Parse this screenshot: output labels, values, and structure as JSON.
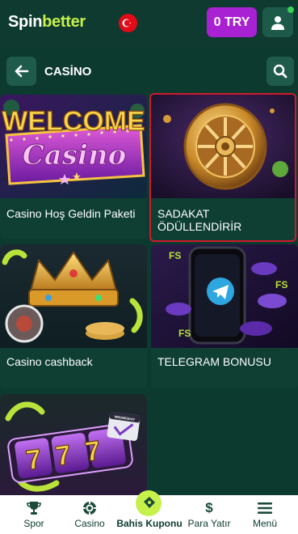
{
  "header": {
    "logo_spin": "Spin",
    "logo_better": "better",
    "balance_label": "0 TRY"
  },
  "titlebar": {
    "title": "CASİNO"
  },
  "cards": [
    {
      "label": "Casino Hoş Geldin Paketi",
      "art_text_1": "WELCOME",
      "art_text_2": "Casino"
    },
    {
      "label": "SADAKAT ÖDÜLLENDİRİR"
    },
    {
      "label": "Casino cashback"
    },
    {
      "label": "TELEGRAM BONUSU",
      "art_badge_1": "FS",
      "art_badge_2": "FS",
      "art_badge_3": "FS"
    },
    {
      "label": "",
      "art_text": "777",
      "art_tag": "WEDNESDAY"
    }
  ],
  "bottom_nav": {
    "items": [
      {
        "label": "Spor",
        "icon": "trophy-icon"
      },
      {
        "label": "Casino",
        "icon": "poker-chip-icon"
      },
      {
        "label": "Bahis Kuponu",
        "icon": "ticket-icon"
      },
      {
        "label": "Para Yatır",
        "icon": "dollar-icon"
      },
      {
        "label": "Menü",
        "icon": "menu-icon"
      }
    ]
  },
  "colors": {
    "background": "#0d3a2f",
    "brand_lime": "#c6f14b",
    "balance_purple": "#a821d3",
    "selected_border": "#d11a2a"
  }
}
